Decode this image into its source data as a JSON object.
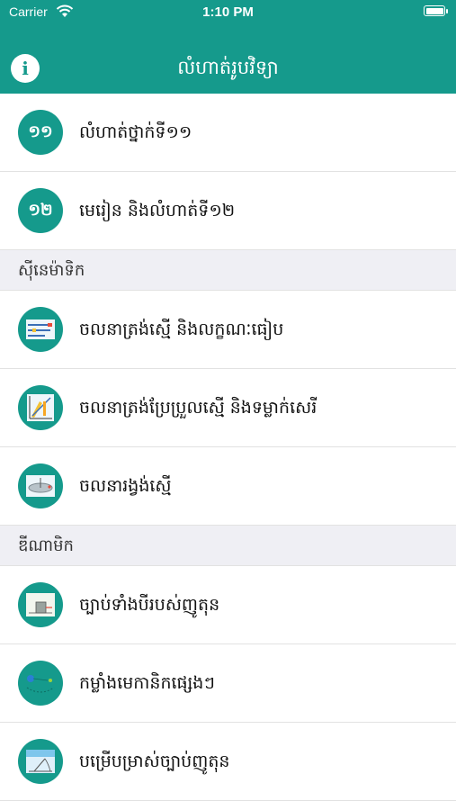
{
  "status_bar": {
    "carrier": "Carrier",
    "time": "1:10 PM"
  },
  "nav": {
    "title": "លំហាត់រូបវិទ្យា",
    "info_label": "i"
  },
  "rows_top": [
    {
      "badge": "១១",
      "label": "លំហាត់ថ្នាក់ទី១១"
    },
    {
      "badge": "១២",
      "label": "មេរៀន និងលំហាត់ទី១២"
    }
  ],
  "sections": [
    {
      "title": "ស៊ីនេម៉ាទិក",
      "items": [
        {
          "label": "ចលនាត្រង់ស្មើ និងលក្ខណៈធៀប",
          "icon": "velocity-graph-icon"
        },
        {
          "label": "ចលនាត្រង់ប្រែប្រួលស្មើ និងទម្លាក់សេរី",
          "icon": "acceleration-graph-icon"
        },
        {
          "label": "ចលនារង្វង់ស្មើ",
          "icon": "circular-disc-icon"
        }
      ]
    },
    {
      "title": "ឌីណាមិក",
      "items": [
        {
          "label": "ច្បាប់ទាំងបីរបស់ញូតុន",
          "icon": "block-force-icon"
        },
        {
          "label": "កម្លាំងមេកានិកផ្សេងៗ",
          "icon": "planet-orbit-icon"
        },
        {
          "label": "បម្រើបម្រាស់ច្បាប់ញូតុន",
          "icon": "incline-projectile-icon"
        }
      ]
    }
  ],
  "colors": {
    "accent": "#159a8c",
    "section_bg": "#efeff4"
  }
}
